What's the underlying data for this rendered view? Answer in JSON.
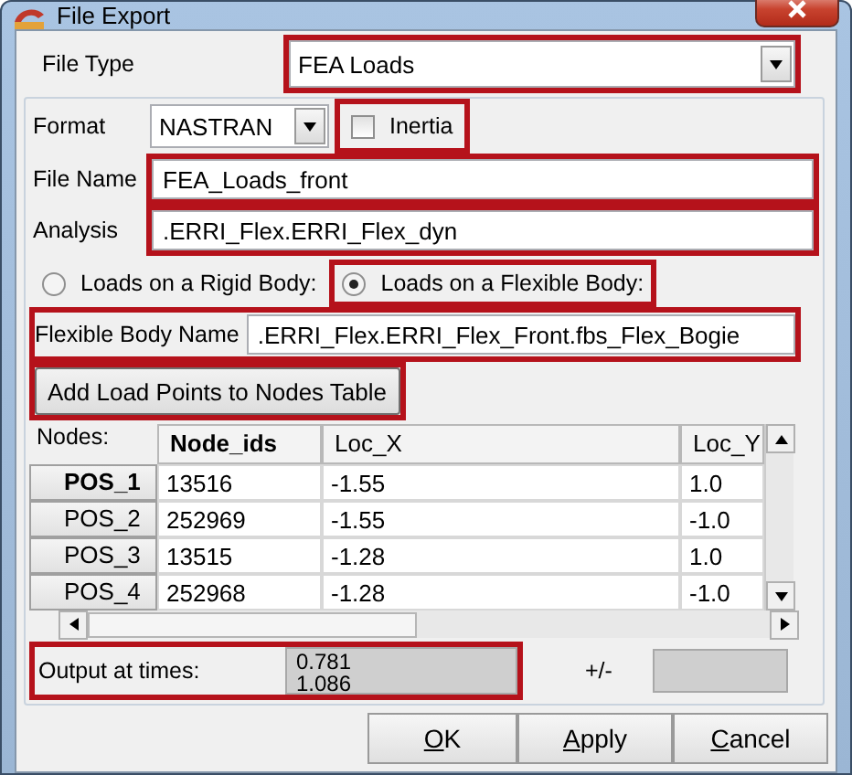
{
  "window": {
    "title": "File Export"
  },
  "file_type": {
    "label": "File Type",
    "value": "FEA Loads",
    "highlighted": true
  },
  "format": {
    "label": "Format",
    "value": "NASTRAN"
  },
  "inertia": {
    "label": "Inertia",
    "checked": false,
    "highlighted": true
  },
  "file_name": {
    "label": "File Name",
    "value": "FEA_Loads_front",
    "highlighted": true
  },
  "analysis": {
    "label": "Analysis",
    "value": ".ERRI_Flex.ERRI_Flex_dyn",
    "highlighted": true
  },
  "load_target": [
    {
      "label": "Loads on a Rigid Body:",
      "selected": false,
      "highlighted": false
    },
    {
      "label": "Loads on a Flexible Body:",
      "selected": true,
      "highlighted": true
    }
  ],
  "flexible_body": {
    "label": "Flexible Body Name",
    "value": ".ERRI_Flex.ERRI_Flex_Front.fbs_Flex_Bogie",
    "highlighted": true
  },
  "add_button": {
    "label": "Add Load Points to Nodes Table",
    "highlighted": true
  },
  "nodes": {
    "label": "Nodes:",
    "columns": [
      {
        "label": "Node_ids",
        "selected": true
      },
      {
        "label": "Loc_X",
        "selected": false
      },
      {
        "label": "Loc_Y",
        "selected": false
      }
    ],
    "rows": [
      {
        "header": "POS_1",
        "selected": true,
        "cells": [
          "13516",
          "-1.55",
          "1.0"
        ]
      },
      {
        "header": "POS_2",
        "selected": false,
        "cells": [
          "252969",
          "-1.55",
          "-1.0"
        ]
      },
      {
        "header": "POS_3",
        "selected": false,
        "cells": [
          "13515",
          "-1.28",
          "1.0"
        ]
      },
      {
        "header": "POS_4",
        "selected": false,
        "cells": [
          "252968",
          "-1.28",
          "-1.0"
        ]
      }
    ]
  },
  "output": {
    "label": "Output at times:",
    "values": [
      "0.781",
      "1.086"
    ],
    "highlighted": true,
    "tolerance_label": "+/-"
  },
  "buttons": [
    "OK",
    "Apply",
    "Cancel"
  ]
}
